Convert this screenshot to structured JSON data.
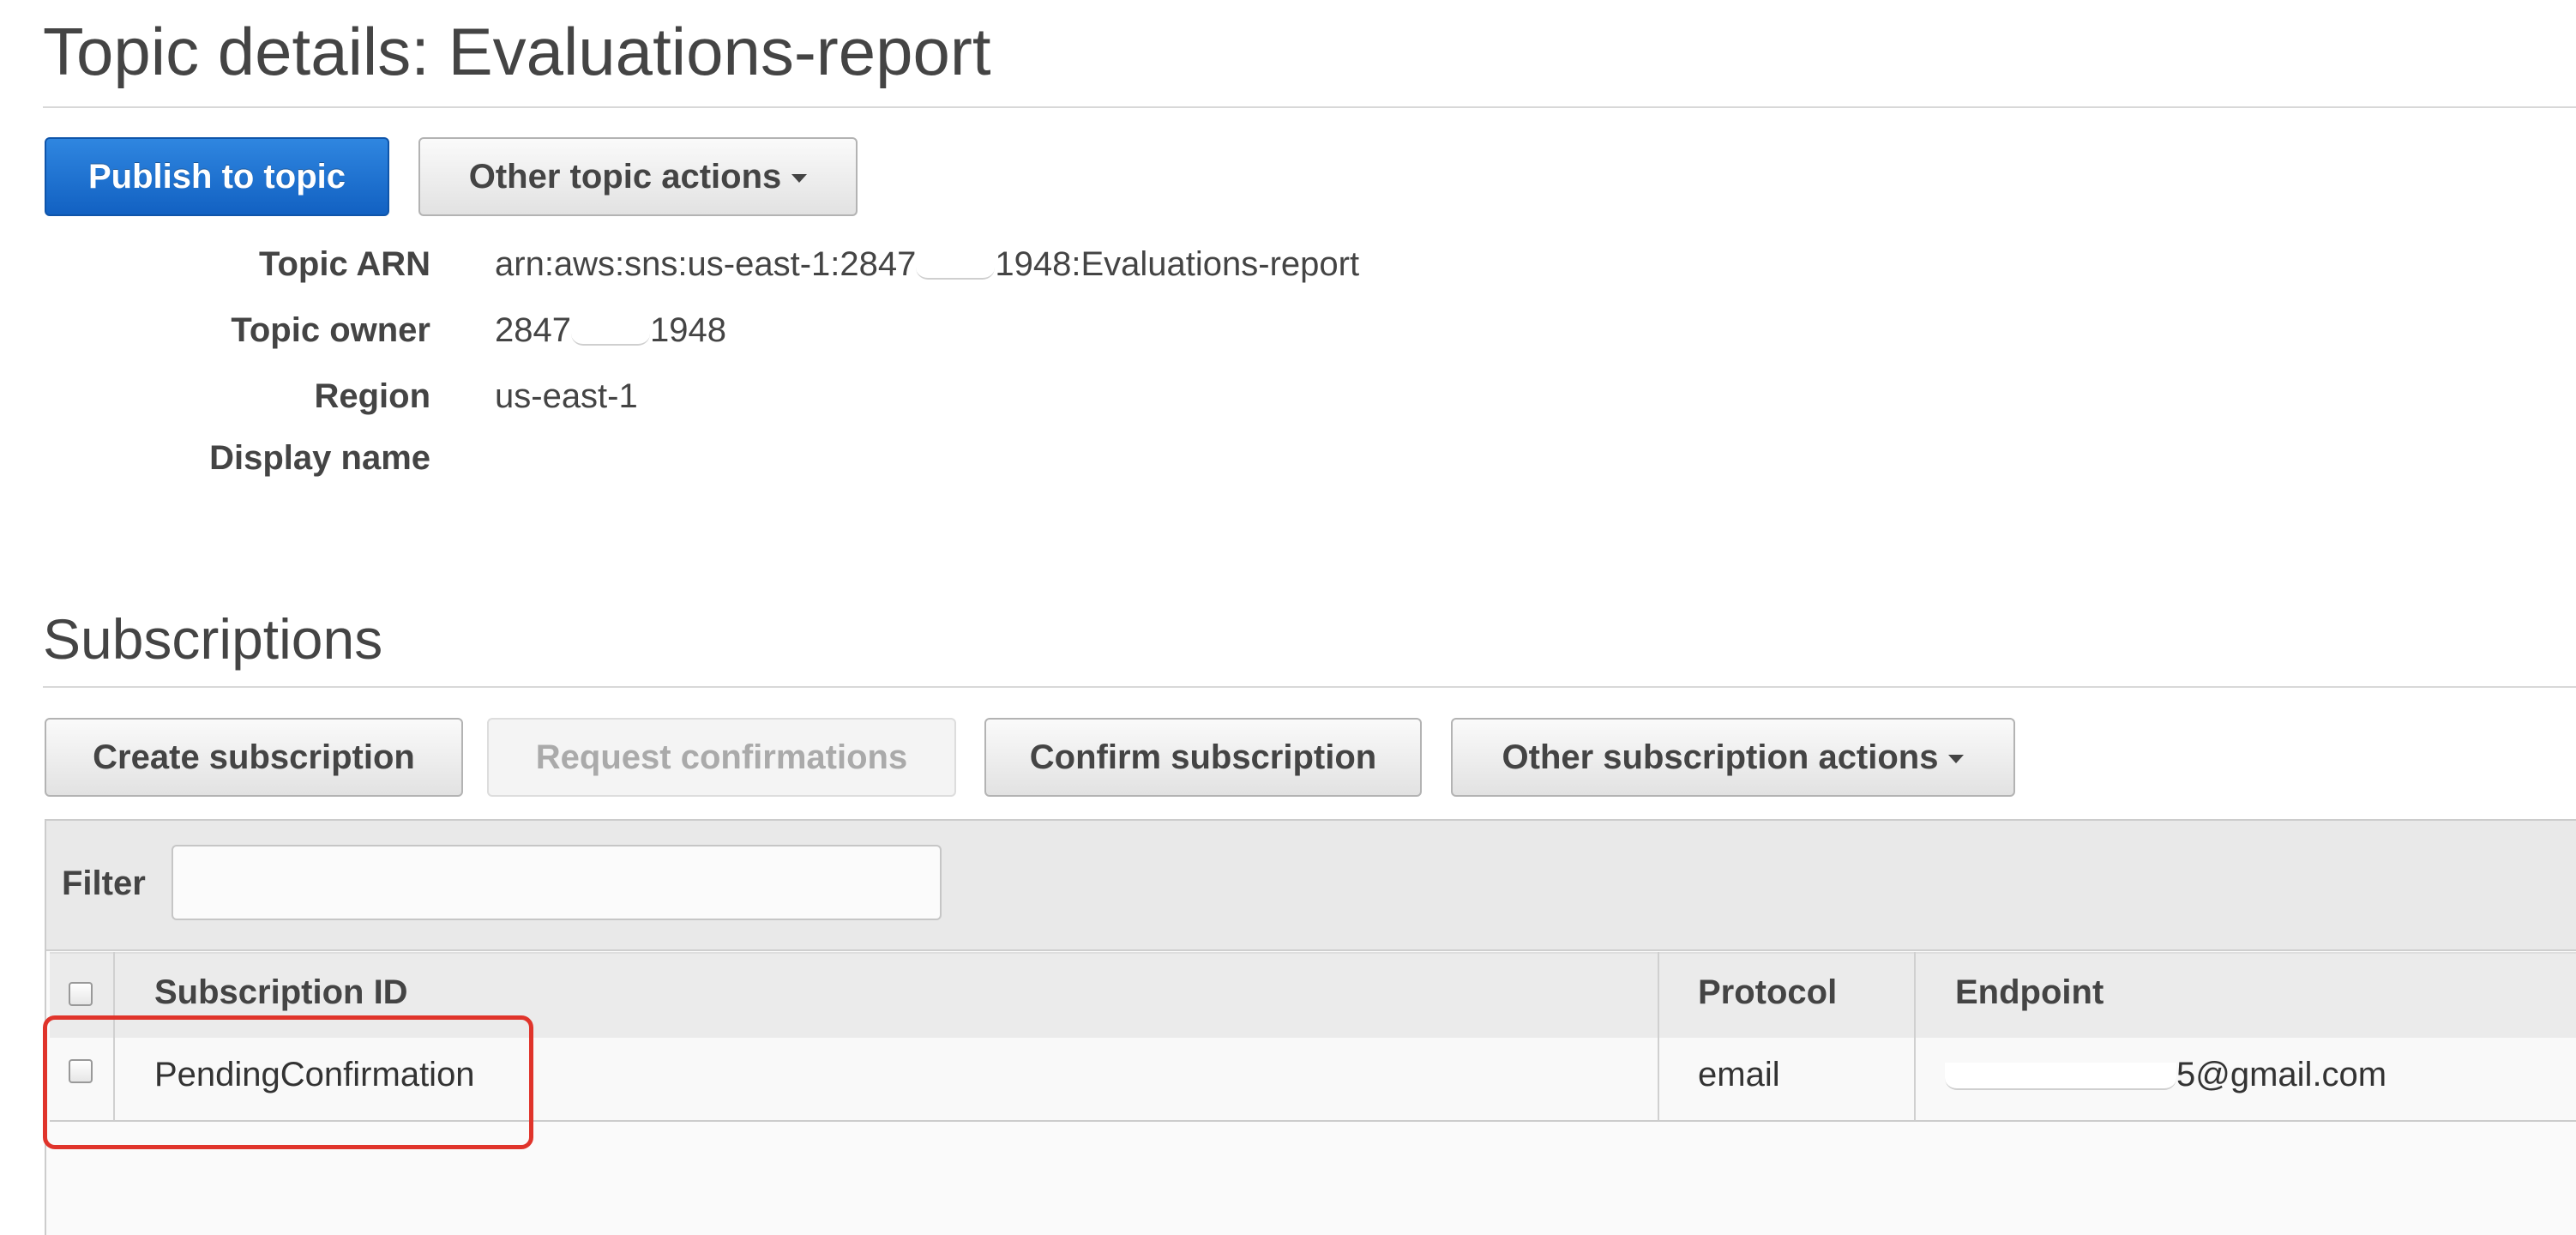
{
  "topic": {
    "heading": "Topic details: Evaluations-report",
    "actions": {
      "publish_label": "Publish to topic",
      "other_label": "Other topic actions"
    },
    "details": [
      {
        "label": "Topic ARN",
        "value_prefix": "arn:aws:sns:us-east-1:2847",
        "value_suffix": "1948:Evaluations-report"
      },
      {
        "label": "Topic owner",
        "value_prefix": "2847",
        "value_suffix": "1948"
      },
      {
        "label": "Region",
        "value_prefix": "us-east-1",
        "value_suffix": ""
      },
      {
        "label": "Display name",
        "value_prefix": "",
        "value_suffix": ""
      }
    ]
  },
  "subscriptions": {
    "heading": "Subscriptions",
    "actions": {
      "create_label": "Create subscription",
      "request_label": "Request confirmations",
      "confirm_label": "Confirm subscription",
      "other_label": "Other subscription actions"
    },
    "filter": {
      "label": "Filter",
      "value": "",
      "placeholder": ""
    },
    "table": {
      "columns": [
        "Subscription ID",
        "Protocol",
        "Endpoint"
      ],
      "rows": [
        {
          "id": "PendingConfirmation",
          "protocol": "email",
          "endpoint_visible": "5@gmail.com"
        }
      ]
    }
  },
  "colors": {
    "primary": "#1a6fd1",
    "highlight": "#e0342b"
  },
  "icons": {
    "dropdown": "caret-down-icon"
  }
}
